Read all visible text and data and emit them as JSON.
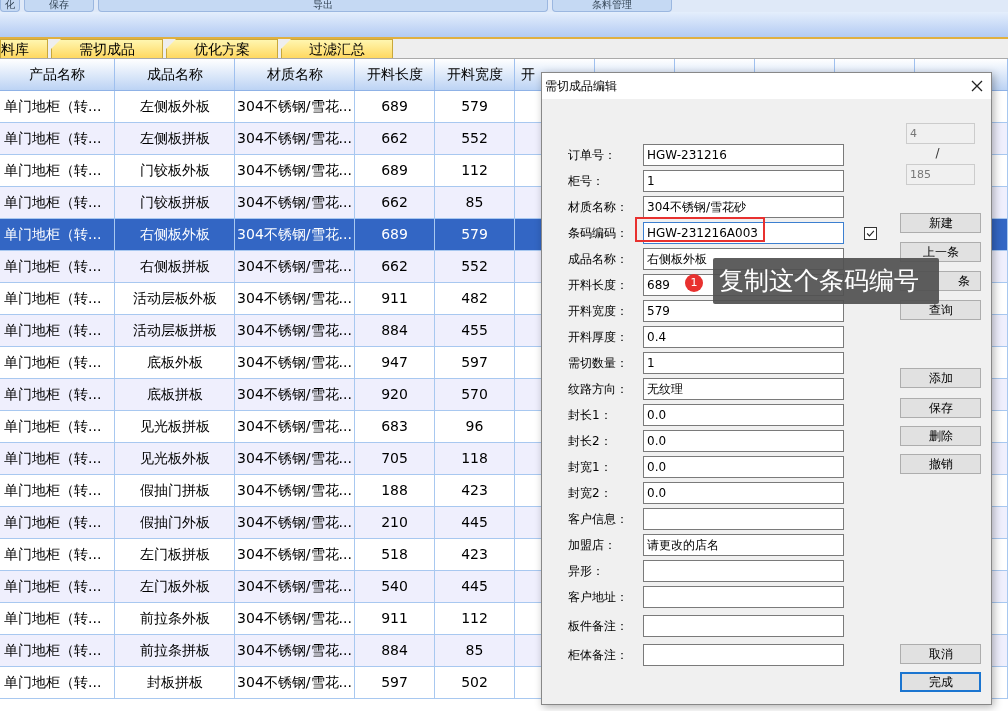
{
  "toolbar": [
    "化",
    "保存",
    "导出",
    "条料管理"
  ],
  "tabs": [
    {
      "label": "料库"
    },
    {
      "label": "需切成品"
    },
    {
      "label": "优化方案"
    },
    {
      "label": "过滤汇总"
    }
  ],
  "table": {
    "columns": [
      "产品名称",
      "成品名称",
      "材质名称",
      "开料长度",
      "开料宽度",
      "开"
    ],
    "rows": [
      {
        "cells": [
          "单门地柜（转...",
          "左侧板外板",
          "304不锈钢/雪花...",
          "689",
          "579"
        ],
        "selected": false
      },
      {
        "cells": [
          "单门地柜（转...",
          "左侧板拼板",
          "304不锈钢/雪花...",
          "662",
          "552"
        ],
        "selected": false
      },
      {
        "cells": [
          "单门地柜（转...",
          "门铰板外板",
          "304不锈钢/雪花...",
          "689",
          "112"
        ],
        "selected": false
      },
      {
        "cells": [
          "单门地柜（转...",
          "门铰板拼板",
          "304不锈钢/雪花...",
          "662",
          "85"
        ],
        "selected": false
      },
      {
        "cells": [
          "单门地柜（转...",
          "右侧板外板",
          "304不锈钢/雪花...",
          "689",
          "579"
        ],
        "selected": true
      },
      {
        "cells": [
          "单门地柜（转...",
          "右侧板拼板",
          "304不锈钢/雪花...",
          "662",
          "552"
        ],
        "selected": false
      },
      {
        "cells": [
          "单门地柜（转...",
          "活动层板外板",
          "304不锈钢/雪花...",
          "911",
          "482"
        ],
        "selected": false
      },
      {
        "cells": [
          "单门地柜（转...",
          "活动层板拼板",
          "304不锈钢/雪花...",
          "884",
          "455"
        ],
        "selected": false
      },
      {
        "cells": [
          "单门地柜（转...",
          "底板外板",
          "304不锈钢/雪花...",
          "947",
          "597"
        ],
        "selected": false
      },
      {
        "cells": [
          "单门地柜（转...",
          "底板拼板",
          "304不锈钢/雪花...",
          "920",
          "570"
        ],
        "selected": false
      },
      {
        "cells": [
          "单门地柜（转...",
          "见光板拼板",
          "304不锈钢/雪花...",
          "683",
          "96"
        ],
        "selected": false
      },
      {
        "cells": [
          "单门地柜（转...",
          "见光板外板",
          "304不锈钢/雪花...",
          "705",
          "118"
        ],
        "selected": false
      },
      {
        "cells": [
          "单门地柜（转...",
          "假抽门拼板",
          "304不锈钢/雪花...",
          "188",
          "423"
        ],
        "selected": false
      },
      {
        "cells": [
          "单门地柜（转...",
          "假抽门外板",
          "304不锈钢/雪花...",
          "210",
          "445"
        ],
        "selected": false
      },
      {
        "cells": [
          "单门地柜（转...",
          "左门板拼板",
          "304不锈钢/雪花...",
          "518",
          "423"
        ],
        "selected": false
      },
      {
        "cells": [
          "单门地柜（转...",
          "左门板外板",
          "304不锈钢/雪花...",
          "540",
          "445"
        ],
        "selected": false
      },
      {
        "cells": [
          "单门地柜（转...",
          "前拉条外板",
          "304不锈钢/雪花...",
          "911",
          "112"
        ],
        "selected": false
      },
      {
        "cells": [
          "单门地柜（转...",
          "前拉条拼板",
          "304不锈钢/雪花...",
          "884",
          "85"
        ],
        "selected": false
      },
      {
        "cells": [
          "单门地柜（转...",
          "封板拼板",
          "304不锈钢/雪花...",
          "597",
          "502"
        ],
        "selected": false
      }
    ]
  },
  "dialog": {
    "title": "需切成品编辑",
    "fields": [
      {
        "label": "订单号：",
        "value": "HGW-231216",
        "highlighted": false
      },
      {
        "label": "柜号：",
        "value": "1",
        "highlighted": false
      },
      {
        "label": "材质名称：",
        "value": "304不锈钢/雪花砂",
        "highlighted": false
      },
      {
        "label": "条码编码：",
        "value": "HGW-231216A003",
        "highlighted": true
      },
      {
        "label": "成品名称：",
        "value": "右侧板外板",
        "highlighted": false
      },
      {
        "label": "开料长度：",
        "value": "689",
        "highlighted": false
      },
      {
        "label": "开料宽度：",
        "value": "579",
        "highlighted": false
      },
      {
        "label": "开料厚度：",
        "value": "0.4",
        "highlighted": false
      },
      {
        "label": "需切数量：",
        "value": "1",
        "highlighted": false
      },
      {
        "label": "纹路方向：",
        "value": "无纹理",
        "highlighted": false
      },
      {
        "label": "封长1：",
        "value": "0.0",
        "highlighted": false
      },
      {
        "label": "封长2：",
        "value": "0.0",
        "highlighted": false
      },
      {
        "label": "封宽1：",
        "value": "0.0",
        "highlighted": false
      },
      {
        "label": "封宽2：",
        "value": "0.0",
        "highlighted": false
      },
      {
        "label": "客户信息：",
        "highlighted": false
      },
      {
        "label": "加盟店：",
        "value": "请更改的店名",
        "highlighted": false
      },
      {
        "label": "异形：",
        "highlighted": false
      },
      {
        "label": "客户地址：",
        "highlighted": false
      },
      {
        "label": "板件备注：",
        "highlighted": false
      },
      {
        "label": "柜体备注：",
        "highlighted": false
      }
    ],
    "barcode_checkbox": {
      "checked": true
    },
    "record_index": "4",
    "separator": "/",
    "record_total": "185",
    "buttons": [
      {
        "label": "新建",
        "focused": false
      },
      {
        "label": "上一条",
        "focused": false
      },
      {
        "label": "条",
        "focused": false
      },
      {
        "label": "查询",
        "focused": false
      },
      {
        "label": "添加",
        "focused": false
      },
      {
        "label": "保存",
        "focused": false
      },
      {
        "label": "删除",
        "focused": false
      },
      {
        "label": "撤销",
        "focused": false
      },
      {
        "label": "取消",
        "focused": false
      },
      {
        "label": "完成",
        "focused": true
      }
    ],
    "tooltip": {
      "badge": "1",
      "text": "复制这个条码编号"
    }
  }
}
